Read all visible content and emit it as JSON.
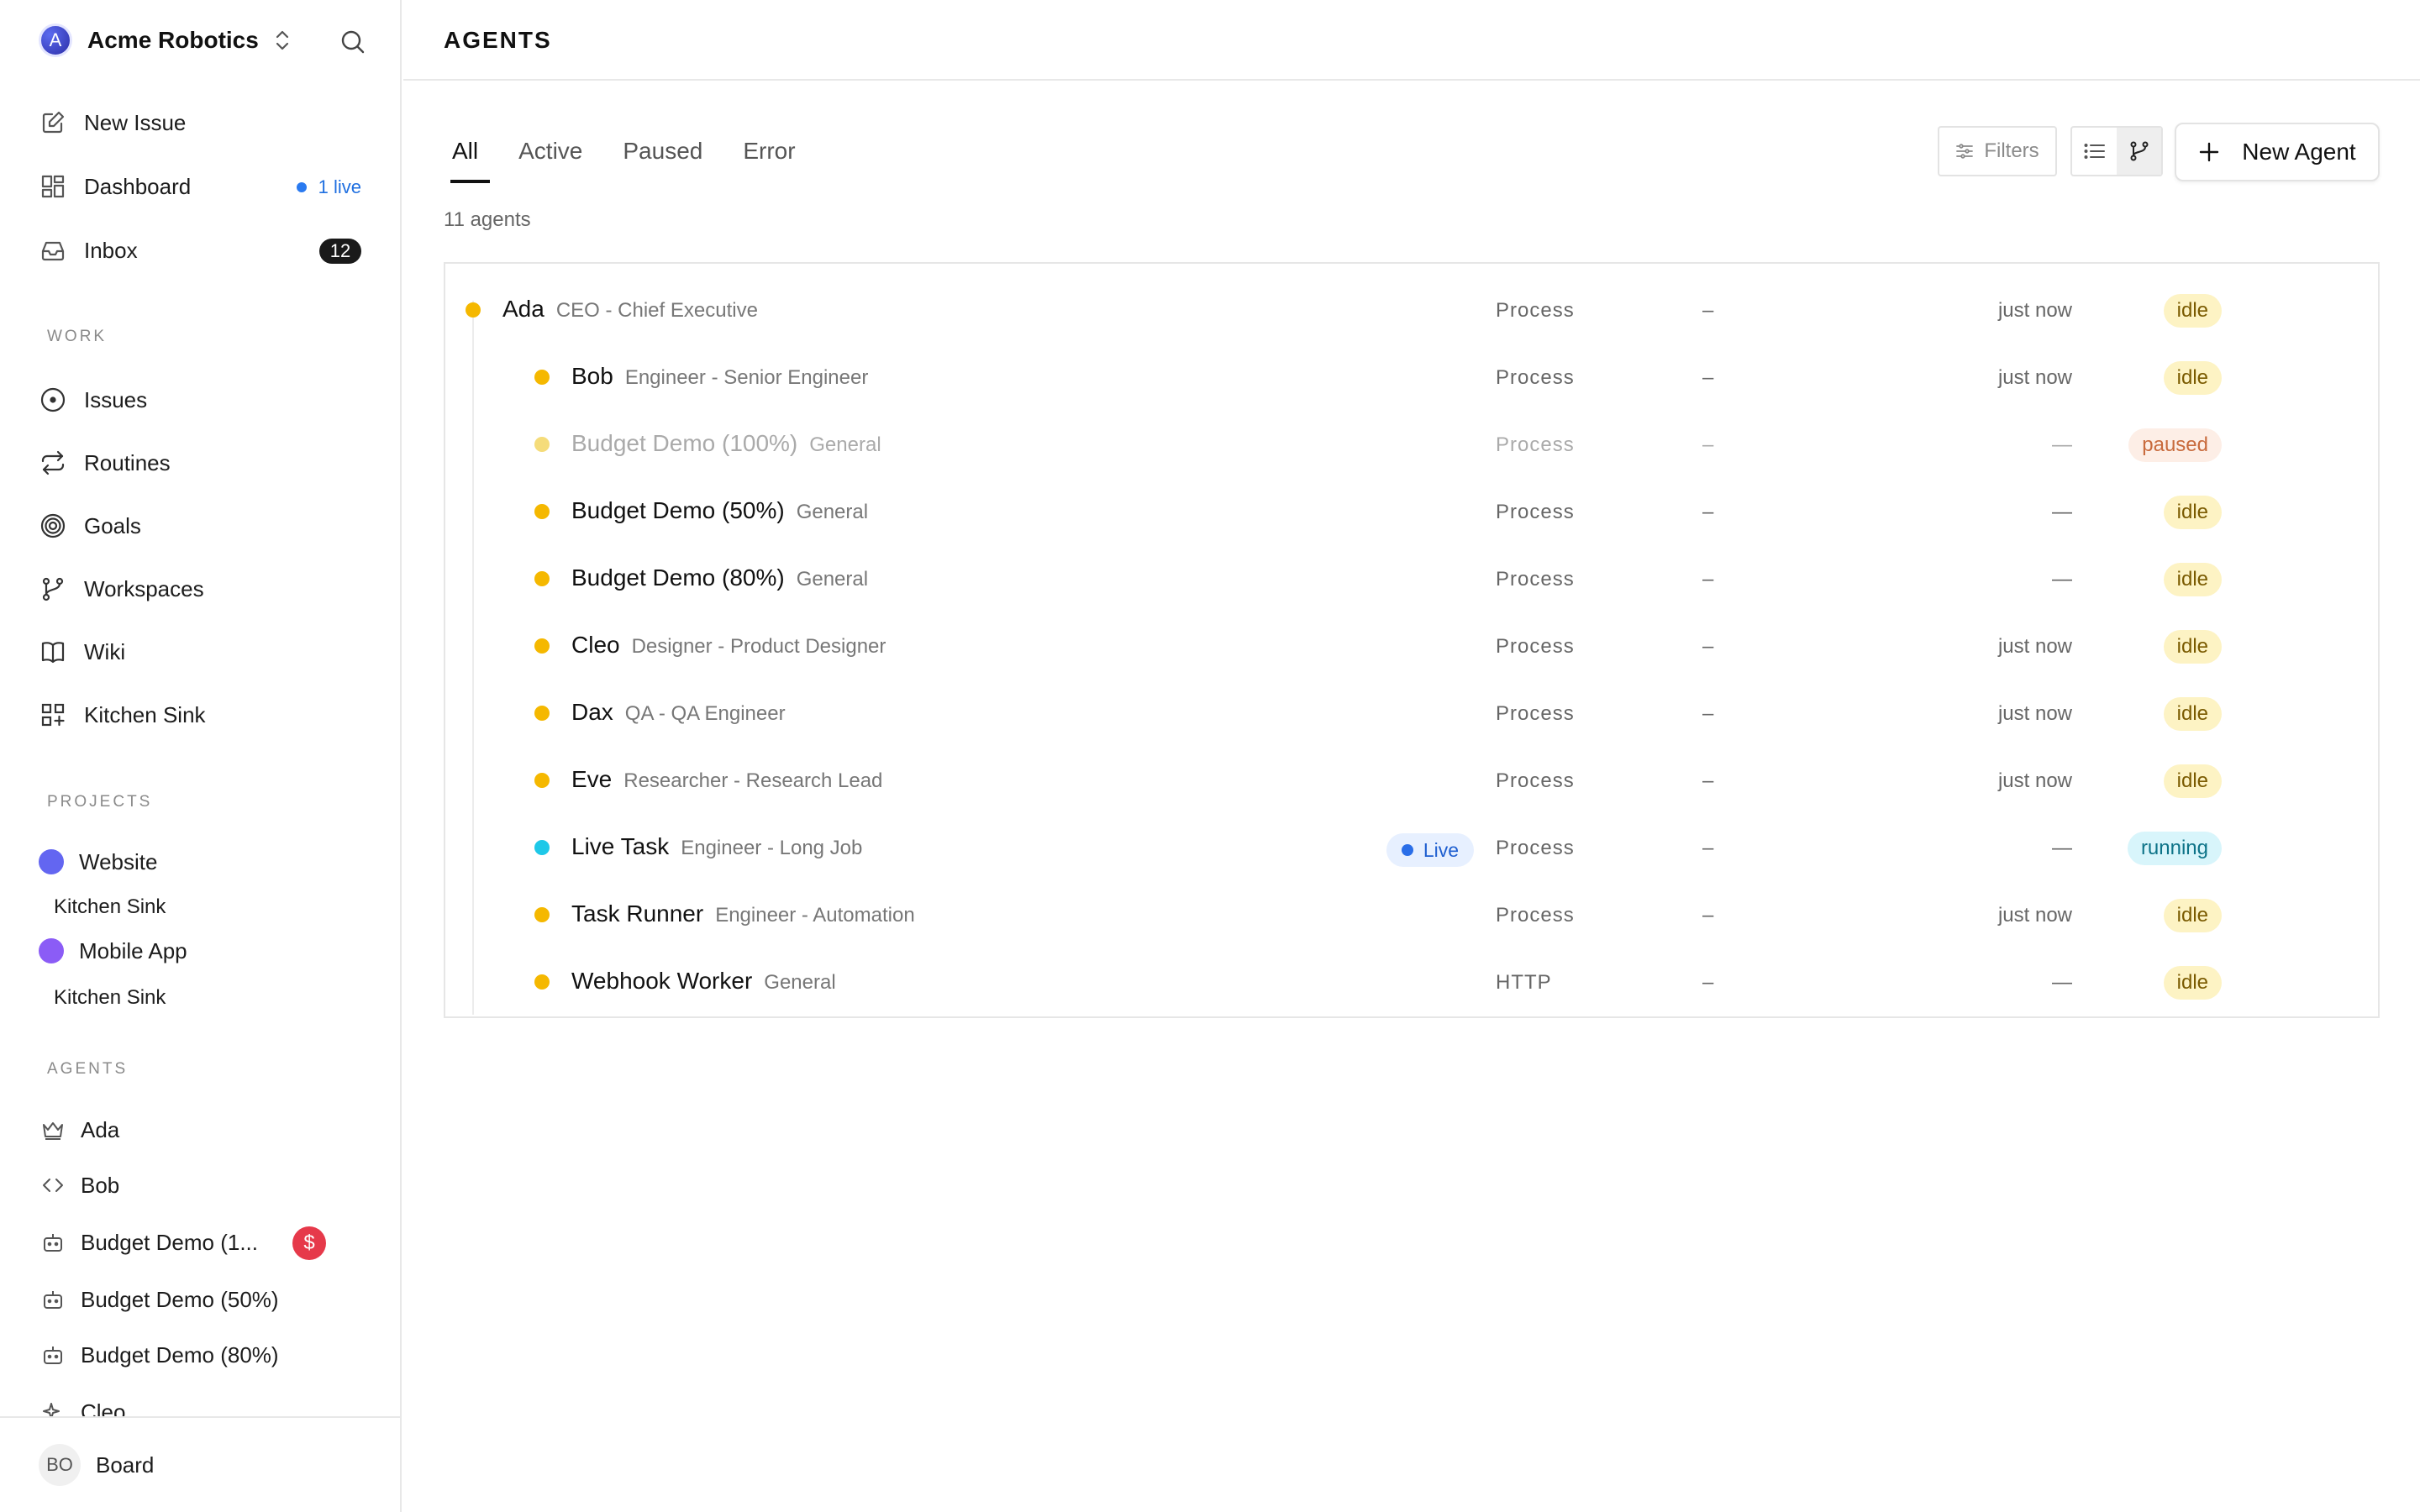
{
  "sidebar": {
    "org": {
      "avatar_letter": "A",
      "name": "Acme Robotics"
    },
    "nav": [
      {
        "label": "New Issue",
        "icon": "edit-icon"
      },
      {
        "label": "Dashboard",
        "icon": "dashboard-icon",
        "live": "1 live"
      },
      {
        "label": "Inbox",
        "icon": "inbox-icon",
        "count": "12"
      }
    ],
    "work_title": "WORK",
    "work": [
      {
        "label": "Issues",
        "icon": "circle-dot-icon"
      },
      {
        "label": "Routines",
        "icon": "repeat-icon"
      },
      {
        "label": "Goals",
        "icon": "target-icon"
      },
      {
        "label": "Workspaces",
        "icon": "git-branch-icon"
      },
      {
        "label": "Wiki",
        "icon": "book-icon"
      },
      {
        "label": "Kitchen Sink",
        "icon": "grid-plus-icon"
      }
    ],
    "projects_title": "PROJECTS",
    "projects": [
      {
        "label": "Website",
        "color": "#6366f1",
        "sub": "Kitchen Sink"
      },
      {
        "label": "Mobile App",
        "color": "#8b5cf6",
        "sub": "Kitchen Sink"
      }
    ],
    "agents_title": "AGENTS",
    "agents": [
      {
        "label": "Ada",
        "icon": "crown-icon"
      },
      {
        "label": "Bob",
        "icon": "code-icon"
      },
      {
        "label": "Budget Demo (1...",
        "icon": "bot-icon",
        "badge": "$"
      },
      {
        "label": "Budget Demo (50%)",
        "icon": "bot-icon"
      },
      {
        "label": "Budget Demo (80%)",
        "icon": "bot-icon"
      },
      {
        "label": "Cleo",
        "icon": "sparkle-icon"
      }
    ],
    "user": {
      "initials": "BO",
      "label": "Board"
    }
  },
  "header": {
    "title": "AGENTS"
  },
  "tabs": [
    "All",
    "Active",
    "Paused",
    "Error"
  ],
  "toolbar": {
    "filters_label": "Filters",
    "new_agent_label": "New Agent"
  },
  "agent_count": "11 agents",
  "colors": {
    "dot_idle": "#f5b800",
    "dot_paused": "#f5dc7a",
    "dot_running": "#1ec8e8"
  },
  "agents": [
    {
      "name": "Ada",
      "role": "CEO - Chief Executive",
      "adapter": "Process",
      "budget": "–",
      "last": "just now",
      "status": "idle",
      "level": 0
    },
    {
      "name": "Bob",
      "role": "Engineer - Senior Engineer",
      "adapter": "Process",
      "budget": "–",
      "last": "just now",
      "status": "idle",
      "level": 1
    },
    {
      "name": "Budget Demo (100%)",
      "role": "General",
      "adapter": "Process",
      "budget": "–",
      "last": "—",
      "status": "paused",
      "level": 1
    },
    {
      "name": "Budget Demo (50%)",
      "role": "General",
      "adapter": "Process",
      "budget": "–",
      "last": "—",
      "status": "idle",
      "level": 1
    },
    {
      "name": "Budget Demo (80%)",
      "role": "General",
      "adapter": "Process",
      "budget": "–",
      "last": "—",
      "status": "idle",
      "level": 1
    },
    {
      "name": "Cleo",
      "role": "Designer - Product Designer",
      "adapter": "Process",
      "budget": "–",
      "last": "just now",
      "status": "idle",
      "level": 1
    },
    {
      "name": "Dax",
      "role": "QA - QA Engineer",
      "adapter": "Process",
      "budget": "–",
      "last": "just now",
      "status": "idle",
      "level": 1
    },
    {
      "name": "Eve",
      "role": "Researcher - Research Lead",
      "adapter": "Process",
      "budget": "–",
      "last": "just now",
      "status": "idle",
      "level": 1
    },
    {
      "name": "Live Task",
      "role": "Engineer - Long Job",
      "adapter": "Process",
      "budget": "–",
      "last": "—",
      "status": "running",
      "level": 1,
      "live": "Live"
    },
    {
      "name": "Task Runner",
      "role": "Engineer - Automation",
      "adapter": "Process",
      "budget": "–",
      "last": "just now",
      "status": "idle",
      "level": 1
    },
    {
      "name": "Webhook Worker",
      "role": "General",
      "adapter": "HTTP",
      "budget": "–",
      "last": "—",
      "status": "idle",
      "level": 1
    }
  ]
}
